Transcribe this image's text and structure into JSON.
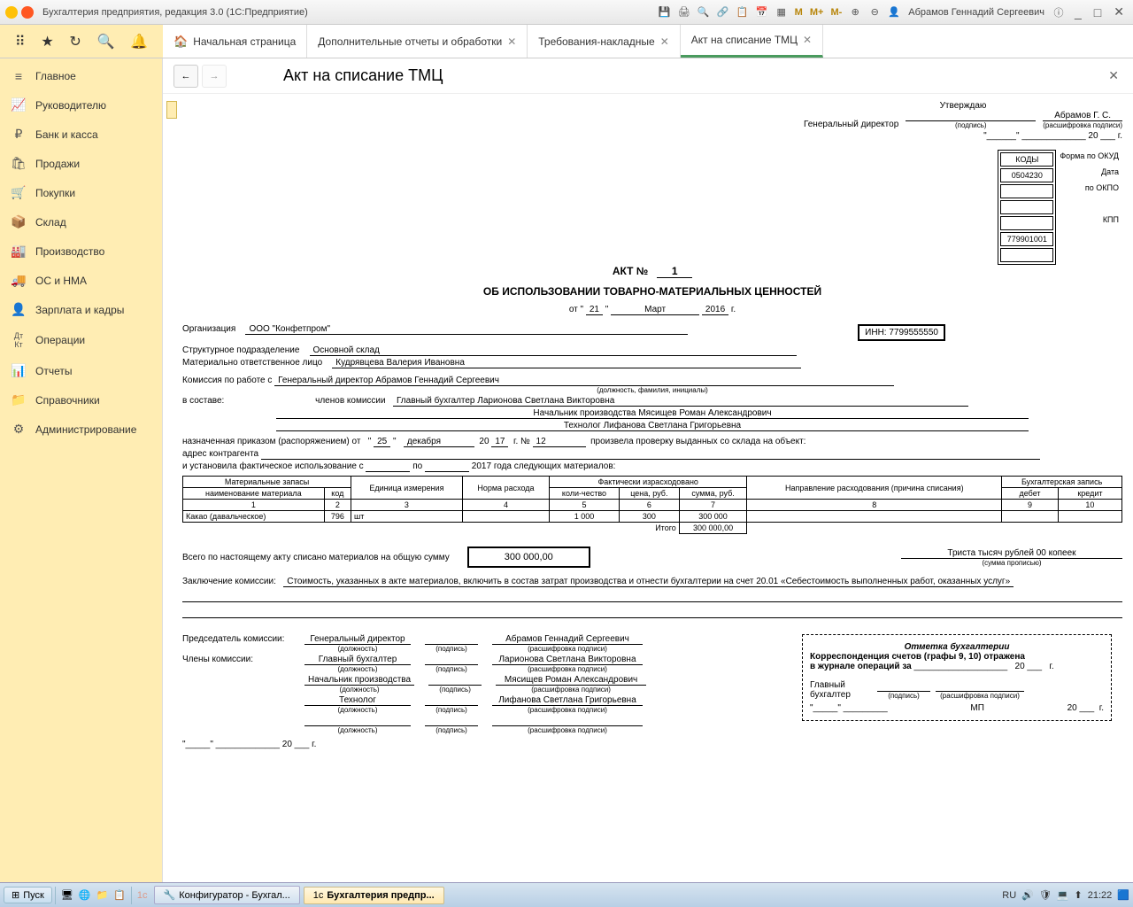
{
  "titlebar": {
    "title": "Бухгалтерия предприятия, редакция 3.0  (1С:Предприятие)",
    "user": "Абрамов Геннадий Сергеевич"
  },
  "tabs": {
    "home": "Начальная страница",
    "t1": "Дополнительные отчеты и обработки",
    "t2": "Требования-накладные",
    "t3": "Акт на списание ТМЦ"
  },
  "sidebar": {
    "items": [
      "Главное",
      "Руководителю",
      "Банк и касса",
      "Продажи",
      "Покупки",
      "Склад",
      "Производство",
      "ОС и НМА",
      "Зарплата и кадры",
      "Операции",
      "Отчеты",
      "Справочники",
      "Администрирование"
    ]
  },
  "content": {
    "title": "Акт на списание ТМЦ"
  },
  "doc": {
    "approve": "Утверждаю",
    "gendir": "Генеральный директор",
    "approver": "Абрамов Г. С.",
    "podpis": "(подпись)",
    "rasshifr": "(расшифровка подписи)",
    "year_suffix": "г.",
    "year20": "20 ___",
    "act_no_label": "АКТ №",
    "act_no": "1",
    "act_title": "ОБ ИСПОЛЬЗОВАНИИ ТОВАРНО-МАТЕРИАЛЬНЫХ ЦЕННОСТЕЙ",
    "ot": "от",
    "day": "21",
    "month": "Март",
    "year": "2016",
    "org_label": "Организация",
    "org": "ООО \"Конфетпром\"",
    "kody": "КОДЫ",
    "okud_label": "Форма по ОКУД",
    "okud": "0504230",
    "data_label": "Дата",
    "okpo_label": "по ОКПО",
    "kpp_label": "КПП",
    "kpp": "779901001",
    "inn_label": "ИНН:",
    "inn": "7799555550",
    "struct_label": "Структурное подразделение",
    "struct": "Основной склад",
    "mol_label": "Материально ответственное лицо",
    "mol": "Кудрявцева Валерия Ивановна",
    "commission_label": "Комиссия по работе с",
    "commission_head": "Генеральный директор  Абрамов Геннадий Сергеевич",
    "dolzhn_fio": "(должность, фамилия, инициалы)",
    "sostav": "в составе:",
    "members_label": "членов комиссии",
    "member1": "Главный бухгалтер  Ларионова Светлана Викторовна",
    "member2": "Начальник производства  Мясищев Роман Александрович",
    "member3": "Технолог Лифанова Светлана Григорьевна",
    "prikaz_label": "назначенная приказом (распоряжением) от",
    "prikaz_day": "25",
    "prikaz_month": "декабря",
    "prikaz_year": "17",
    "prikaz_no_label": "г.  №",
    "prikaz_no": "12",
    "prikaz_tail": "произвела проверку выданных со склада на объект:",
    "adres": "адрес контрагента",
    "usage_label": "и установила фактическое использование с",
    "usage_po": "по",
    "usage_year": "2017 года следующих материалов:",
    "th_mat": "Материальные запасы",
    "th_name": "наименование материала",
    "th_code": "код",
    "th_unit": "Единица измерения",
    "th_norm": "Норма расхода",
    "th_fact": "Фактически израсходовано",
    "th_qty": "коли-чество",
    "th_price": "цена, руб.",
    "th_sum": "сумма, руб.",
    "th_dir": "Направление расходования (причина списания)",
    "th_acc": "Бухгалтерская запись",
    "th_debit": "дебет",
    "th_credit": "кредит",
    "row": {
      "name": "Какао (давальческое)",
      "code": "796",
      "unit": "шт",
      "qty": "1 000",
      "price": "300",
      "sum": "300 000"
    },
    "itogo": "Итого",
    "itogo_sum": "300 000,00",
    "total_label": "Всего по настоящему акту списано материалов на общую сумму",
    "total": "300 000,00",
    "total_words": "Триста тысяч рублей 00 копеек",
    "sum_words_sub": "(сумма прописью)",
    "zakl_label": "Заключение комиссии:",
    "zakl": "Стоимость, указанных в акте материалов, включить в состав затрат производства и отнести бухгалтерии на счет 20.01 «Себестоимость выполненных работ, оказанных услуг»",
    "preds": "Председатель комиссии:",
    "members": "Члены комиссии:",
    "dolzhn": "(должность)",
    "p1_role": "Генеральный директор",
    "p1_name": "Абрамов Геннадий Сергеевич",
    "p2_role": "Главный бухгалтер",
    "p2_name": "Ларионова Светлана Викторовна",
    "p3_role": "Начальник производства",
    "p3_name": "Мясищев Роман Александрович",
    "p4_role": "Технолог",
    "p4_name": "Лифанова Светлана Григорьевна",
    "acc_note_hdr": "Отметка бухгалтерии",
    "acc_note_l1": "Корреспонденция счетов (графы 9, 10) отражена",
    "acc_note_l2": "в журнале операций за",
    "glavbukh": "Главный бухгалтер",
    "mp": "МП"
  },
  "taskbar": {
    "start": "Пуск",
    "t1": "Конфигуратор - Бухгал...",
    "t2": "Бухгалтерия предпр...",
    "lang": "RU",
    "time": "21:22"
  }
}
